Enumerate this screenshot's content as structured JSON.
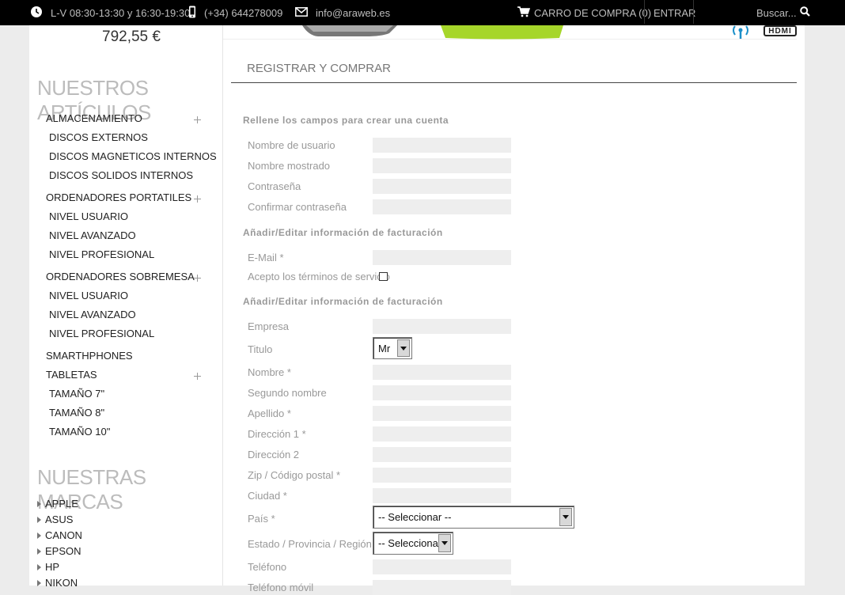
{
  "topbar": {
    "hours": "L-V 08:30-13:30 y 16:30-19:30",
    "phone": "(+34) 644278009",
    "email": "info@araweb.es",
    "cart": "CARRO DE COMPRA (0)",
    "login": "ENTRAR",
    "search": "Buscar..."
  },
  "sidebar": {
    "price": "792,55 €",
    "articles_title": "NUESTROS ARTÍCULOS",
    "categories": [
      {
        "label": "ALMACENAMIENTO"
      },
      {
        "label": "DISCOS EXTERNOS"
      },
      {
        "label": "DISCOS MAGNETICOS INTERNOS"
      },
      {
        "label": "DISCOS SOLIDOS INTERNOS"
      },
      {
        "label": "ORDENADORES PORTATILES"
      },
      {
        "label": "NIVEL USUARIO"
      },
      {
        "label": "NIVEL AVANZADO"
      },
      {
        "label": "NIVEL PROFESIONAL"
      },
      {
        "label": "ORDENADORES SOBREMESA"
      },
      {
        "label": "NIVEL USUARIO"
      },
      {
        "label": "NIVEL AVANZADO"
      },
      {
        "label": "NIVEL PROFESIONAL"
      },
      {
        "label": "SMARTHPHONES"
      },
      {
        "label": "TABLETAS"
      },
      {
        "label": "TAMAÑO 7\""
      },
      {
        "label": "TAMAÑO 8\""
      },
      {
        "label": "TAMAÑO 10\""
      }
    ],
    "brands_title": "NUESTRAS MARCAS",
    "brands": [
      "APPLE",
      "ASUS",
      "CANON",
      "EPSON",
      "HP",
      "NIKON"
    ]
  },
  "banner": {
    "hdmi_logo": "HDMI"
  },
  "main": {
    "heading": "REGISTRAR Y COMPRAR",
    "section_account": "Rellene los campos para crear una cuenta",
    "username": "Nombre de usuario",
    "display_name": "Nombre mostrado",
    "password": "Contraseña",
    "confirm_password": "Confirmar contraseña",
    "section_billing_1": "Añadir/Editar información de facturación",
    "email": "E-Mail *",
    "terms": "Acepto los términos de servicio",
    "section_billing_2": "Añadir/Editar información de facturación",
    "company": "Empresa",
    "title": "Titulo",
    "title_value": "Mr",
    "first_name": "Nombre *",
    "middle_name": "Segundo nombre",
    "last_name": "Apellido *",
    "address1": "Dirección 1 *",
    "address2": "Dirección 2",
    "zip": "Zip / Código postal *",
    "city": "Ciudad *",
    "country": "País *",
    "country_value": "-- Seleccionar --",
    "state": "Estado / Provincia / Región *",
    "state_value": "-- Seleccionar --",
    "phone": "Teléfono",
    "mobile": "Teléfono móvil"
  }
}
